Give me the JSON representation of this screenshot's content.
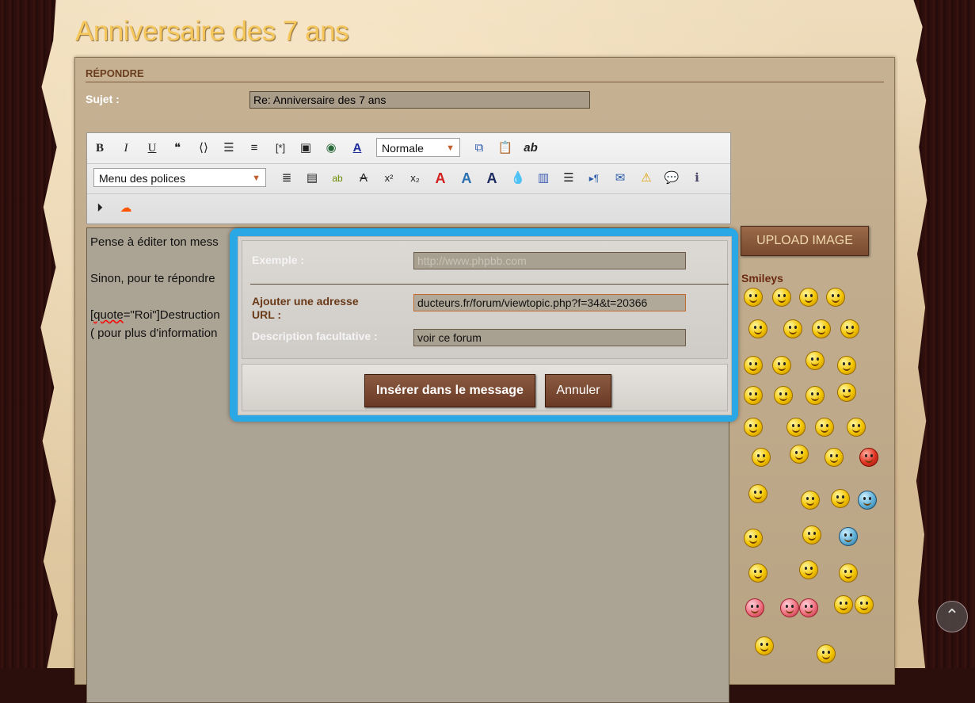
{
  "page": {
    "topic_title": "Anniversaire des 7 ans"
  },
  "reply": {
    "heading": "RÉPONDRE",
    "subject_label": "Sujet :",
    "subject_value": "Re: Anniversaire des 7 ans"
  },
  "toolbar": {
    "size_select": "Normale",
    "font_menu": "Menu des polices"
  },
  "editor": {
    "line1": "Pense à éditer ton mess",
    "line2": "Sinon, pour te répondre",
    "line3_prefix": "[",
    "line3_wavy": "quote",
    "line3_rest": "=\"Roi\"]Destruction",
    "line4": "( pour plus d'information"
  },
  "sidebar": {
    "upload_label": "UPLOAD IMAGE",
    "smileys_title": "Smileys"
  },
  "link_dialog": {
    "example_label": "Exemple :",
    "example_placeholder": "http://www.phpbb.com",
    "url_label_line1": "Ajouter une adresse",
    "url_label_line2": "URL :",
    "url_value": "ducteurs.fr/forum/viewtopic.php?f=34&t=20366",
    "desc_label": "Description facultative :",
    "desc_value": "voir ce forum",
    "insert_label": "Insérer dans le message",
    "cancel_label": "Annuler"
  },
  "colors": {
    "accent_blue": "#29a8e6",
    "title_gold": "#f5c65a",
    "button_brown": "#7a4a30"
  }
}
